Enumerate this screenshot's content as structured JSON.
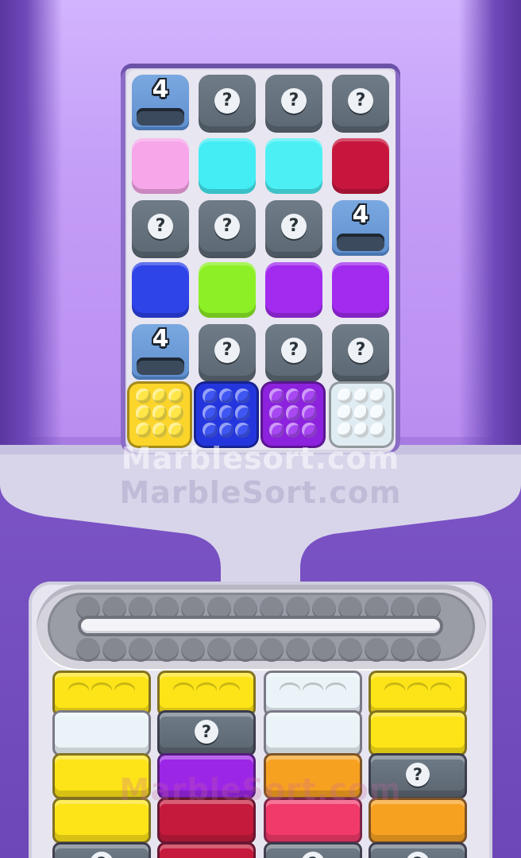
{
  "watermark": {
    "line1": "Marblesort.com",
    "line2": "MarbleSort.com",
    "line3": "MarbleSort.com"
  },
  "grid": {
    "rows": [
      [
        {
          "kind": "tunnel",
          "count": "4"
        },
        {
          "kind": "qmark",
          "label": "?"
        },
        {
          "kind": "qmark",
          "label": "?"
        },
        {
          "kind": "qmark",
          "label": "?"
        }
      ],
      [
        {
          "kind": "solid",
          "color": "#f7a6ea",
          "name": "pink"
        },
        {
          "kind": "solid",
          "color": "#44ecf4",
          "name": "cyan"
        },
        {
          "kind": "solid",
          "color": "#4cf0f4",
          "name": "cyan"
        },
        {
          "kind": "solid",
          "color": "#c7163d",
          "name": "crimson"
        }
      ],
      [
        {
          "kind": "qmark",
          "label": "?"
        },
        {
          "kind": "qmark",
          "label": "?"
        },
        {
          "kind": "qmark",
          "label": "?"
        },
        {
          "kind": "tunnel",
          "count": "4"
        }
      ],
      [
        {
          "kind": "solid",
          "color": "#2e43e8",
          "name": "blue"
        },
        {
          "kind": "solid",
          "color": "#8df026",
          "name": "lime"
        },
        {
          "kind": "solid",
          "color": "#a22bef",
          "name": "purple"
        },
        {
          "kind": "solid",
          "color": "#a22bef",
          "name": "purple"
        }
      ],
      [
        {
          "kind": "tunnel",
          "count": "4"
        },
        {
          "kind": "qmark",
          "label": "?"
        },
        {
          "kind": "qmark",
          "label": "?"
        },
        {
          "kind": "qmark",
          "label": "?"
        }
      ]
    ],
    "boxes": [
      {
        "color": "#fcd52a",
        "ball": "#ffe649",
        "name": "yellow"
      },
      {
        "color": "#2336de",
        "ball": "#3f56f2",
        "name": "blue"
      },
      {
        "color": "#8c22dd",
        "ball": "#a748f2",
        "name": "purple"
      },
      {
        "color": "#dfecf2",
        "ball": "#f4fafd",
        "name": "white"
      }
    ]
  },
  "crates": {
    "columns": [
      [
        {
          "kind": "pegs",
          "color": "#fde418",
          "name": "yellow"
        },
        {
          "kind": "solid",
          "color": "#eaf4f8",
          "name": "white"
        },
        {
          "kind": "solid",
          "color": "#fde418",
          "name": "yellow"
        },
        {
          "kind": "solid",
          "color": "#fde418",
          "name": "yellow"
        },
        {
          "kind": "qmark",
          "label": "?"
        }
      ],
      [
        {
          "kind": "pegs",
          "color": "#fde418",
          "name": "yellow"
        },
        {
          "kind": "qmark",
          "label": "?"
        },
        {
          "kind": "solid",
          "color": "#9c26e6",
          "name": "purple"
        },
        {
          "kind": "solid",
          "color": "#c51a3c",
          "name": "crimson"
        },
        {
          "kind": "solid",
          "color": "#c51a3c",
          "name": "crimson"
        }
      ],
      [
        {
          "kind": "pegs",
          "color": "#eaf4f8",
          "name": "white"
        },
        {
          "kind": "solid",
          "color": "#eaf4f8",
          "name": "white"
        },
        {
          "kind": "solid",
          "color": "#f7a121",
          "name": "orange"
        },
        {
          "kind": "solid",
          "color": "#f13a6a",
          "name": "rose"
        },
        {
          "kind": "qmark",
          "label": "?"
        }
      ],
      [
        {
          "kind": "pegs",
          "color": "#fde418",
          "name": "yellow"
        },
        {
          "kind": "solid",
          "color": "#fde418",
          "name": "yellow"
        },
        {
          "kind": "qmark",
          "label": "?"
        },
        {
          "kind": "solid",
          "color": "#f7a121",
          "name": "orange"
        },
        {
          "kind": "qmark",
          "label": "?"
        }
      ]
    ]
  }
}
